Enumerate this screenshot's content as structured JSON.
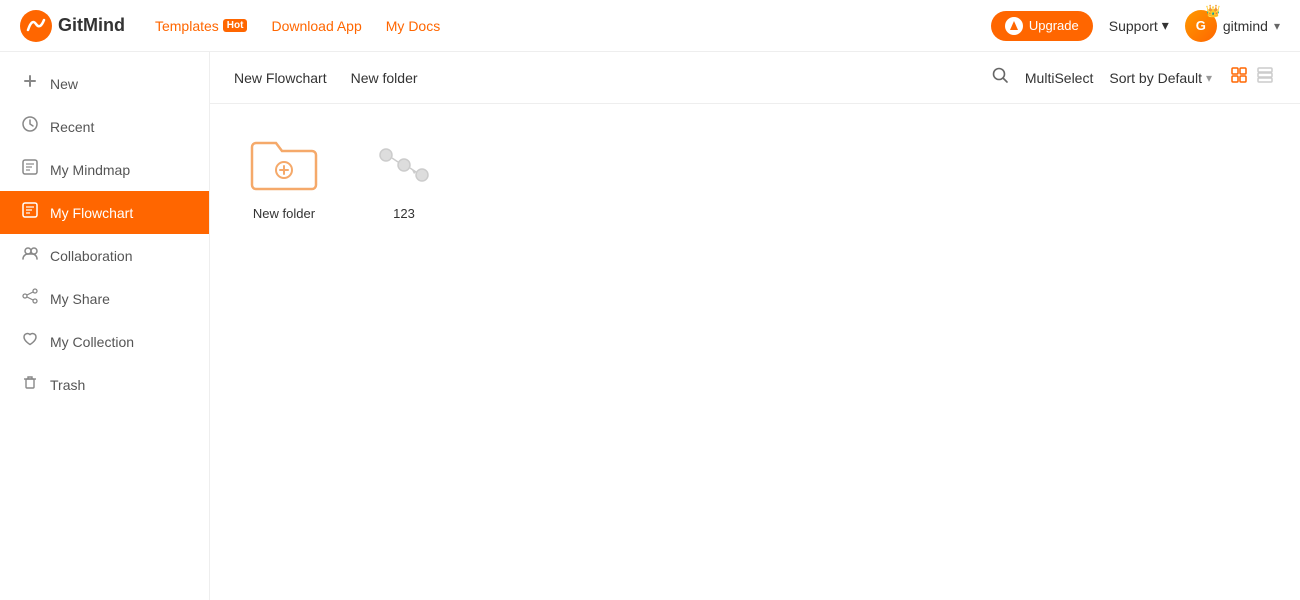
{
  "header": {
    "logo_text": "GitMind",
    "nav": {
      "templates_label": "Templates",
      "hot_badge": "Hot",
      "download_app_label": "Download App",
      "my_docs_label": "My Docs"
    },
    "upgrade_label": "Upgrade",
    "support_label": "Support",
    "user_name": "gitmind"
  },
  "sidebar": {
    "items": [
      {
        "id": "new",
        "label": "New",
        "icon": "➕"
      },
      {
        "id": "recent",
        "label": "Recent",
        "icon": "🕐"
      },
      {
        "id": "my-mindmap",
        "label": "My Mindmap",
        "icon": "📄"
      },
      {
        "id": "my-flowchart",
        "label": "My Flowchart",
        "icon": "📋",
        "active": true
      },
      {
        "id": "collaboration",
        "label": "Collaboration",
        "icon": "👥"
      },
      {
        "id": "my-share",
        "label": "My Share",
        "icon": "🔗"
      },
      {
        "id": "my-collection",
        "label": "My Collection",
        "icon": "🤍"
      },
      {
        "id": "trash",
        "label": "Trash",
        "icon": "🗑️"
      }
    ]
  },
  "toolbar": {
    "new_flowchart_label": "New Flowchart",
    "new_folder_label": "New folder",
    "multiselect_label": "MultiSelect",
    "sort_label": "Sort by Default",
    "view_grid_label": "Grid view",
    "view_list_label": "List view"
  },
  "files": [
    {
      "id": "new-folder",
      "name": "New folder",
      "type": "folder"
    },
    {
      "id": "123",
      "name": "123",
      "type": "flowchart"
    }
  ]
}
